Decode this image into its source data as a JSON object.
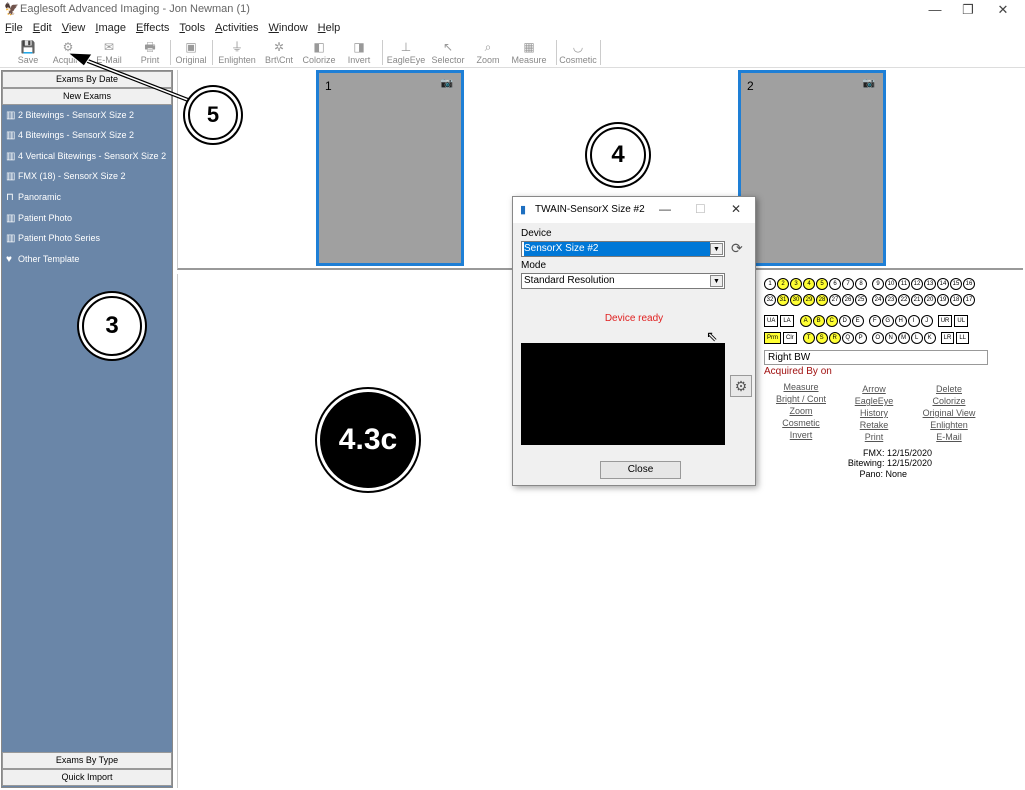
{
  "window": {
    "title": "Eaglesoft Advanced Imaging - Jon Newman (1)",
    "minimize": "—",
    "restore": "❐",
    "close": "✕"
  },
  "menu": [
    "File",
    "Edit",
    "View",
    "Image",
    "Effects",
    "Tools",
    "Activities",
    "Window",
    "Help"
  ],
  "toolbar": {
    "save": "Save",
    "acquire": "Acquire",
    "email": "E-Mail",
    "print": "Print",
    "original": "Original",
    "enlighten": "Enlighten",
    "brtcnt": "Brt\\Cnt",
    "colorize": "Colorize",
    "invert": "Invert",
    "eagleeye": "EagleEye",
    "selector": "Selector",
    "zoom": "Zoom",
    "measure": "Measure",
    "cosmetic": "Cosmetic"
  },
  "sidebar": {
    "exams_by_date": "Exams By Date",
    "new_exams": "New Exams",
    "items": [
      "2 Bitewings - SensorX Size 2",
      "4 Bitewings - SensorX Size 2",
      "4 Vertical Bitewings - SensorX Size 2",
      "FMX (18) - SensorX Size 2",
      "Panoramic",
      "Patient Photo",
      "Patient Photo Series",
      "Other Template"
    ],
    "exams_by_type": "Exams By Type",
    "quick_import": "Quick Import"
  },
  "thumbnails": [
    {
      "number": "1"
    },
    {
      "number": "2"
    }
  ],
  "teeth": {
    "upper": [
      "1",
      "2",
      "3",
      "4",
      "5",
      "6",
      "7",
      "8",
      "9",
      "10",
      "11",
      "12",
      "13",
      "14",
      "15",
      "16"
    ],
    "lower": [
      "32",
      "31",
      "30",
      "29",
      "28",
      "27",
      "26",
      "25",
      "24",
      "23",
      "22",
      "21",
      "20",
      "19",
      "18",
      "17"
    ],
    "upper_primary": [
      "A",
      "B",
      "C",
      "D",
      "E",
      "F",
      "G",
      "H",
      "I",
      "J"
    ],
    "lower_primary": [
      "T",
      "S",
      "R",
      "Q",
      "P",
      "O",
      "N",
      "M",
      "L",
      "K"
    ],
    "boxes_left_top": [
      "UA",
      "LA"
    ],
    "boxes_right_top": [
      "UR",
      "UL"
    ],
    "boxes_left_bottom": [
      "Prm",
      "Clr"
    ],
    "boxes_right_bottom": [
      "LR",
      "LL"
    ],
    "highlight_color": "#ffff33"
  },
  "image_info": {
    "name": "Right BW",
    "acquired_by": "Acquired By  on"
  },
  "links": {
    "col1": [
      "Measure",
      "Bright / Cont",
      "Zoom",
      "Cosmetic",
      "Invert"
    ],
    "col2": [
      "Arrow",
      "EagleEye",
      "History",
      "Retake",
      "Print"
    ],
    "col3": [
      "Delete",
      "Colorize",
      "Original View",
      "Enlighten",
      "E-Mail"
    ]
  },
  "dates": {
    "fmx": "FMX: 12/15/2020",
    "bitewing": "Bitewing: 12/15/2020",
    "pano": "Pano: None"
  },
  "dialog": {
    "title": "TWAIN-SensorX Size #2",
    "device_label": "Device",
    "device_value": "SensorX Size #2",
    "mode_label": "Mode",
    "mode_value": "Standard Resolution",
    "status": "Device ready",
    "close_label": "Close"
  },
  "callouts": {
    "c5": "5",
    "c4": "4",
    "c3": "3",
    "c43c": "4.3c"
  },
  "colors": {
    "sidebar": "#6a86a8",
    "thumb_border": "#1e7fd6",
    "status_red": "#e02020"
  }
}
